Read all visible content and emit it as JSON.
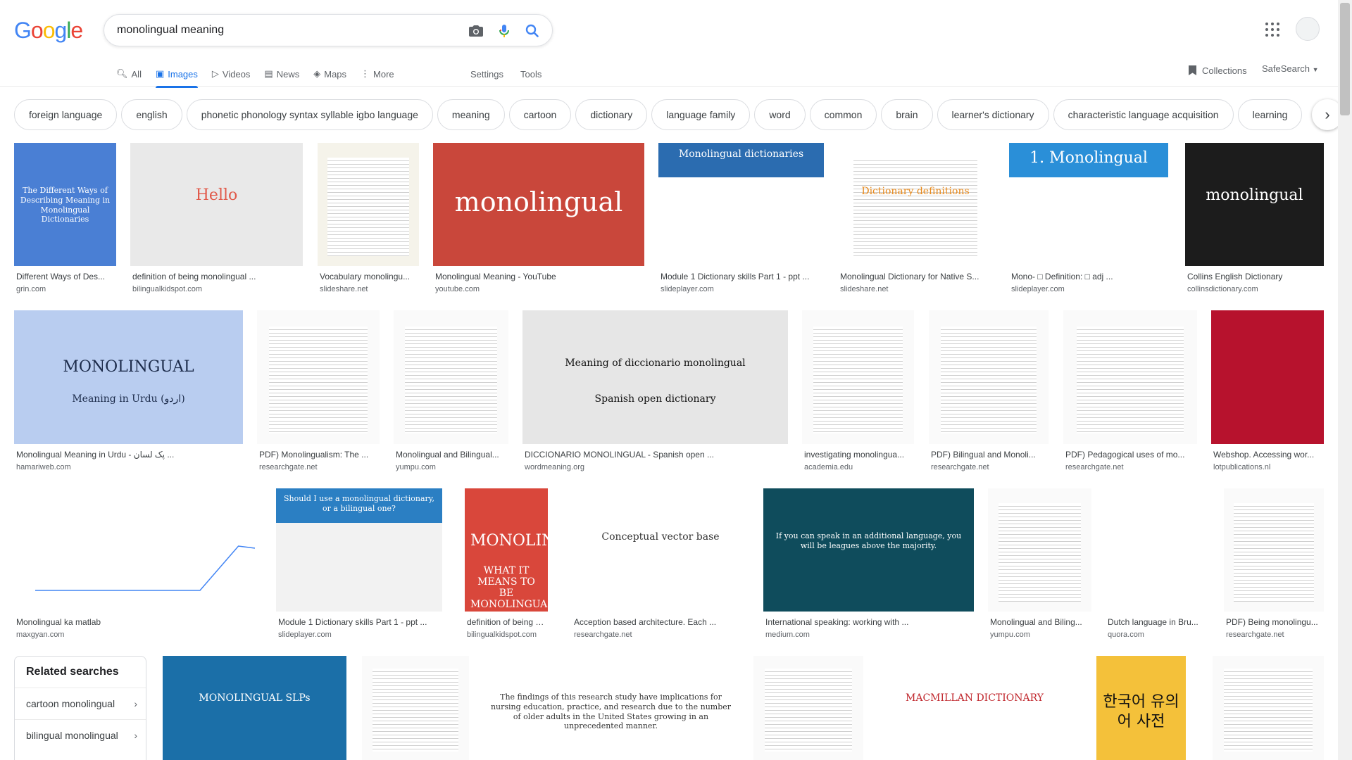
{
  "logo": [
    "G",
    "o",
    "o",
    "g",
    "l",
    "e"
  ],
  "search": {
    "query": "monolingual meaning"
  },
  "tabs": [
    {
      "label": "All",
      "icon": "search-icon"
    },
    {
      "label": "Images",
      "icon": "image-icon"
    },
    {
      "label": "Videos",
      "icon": "play-icon"
    },
    {
      "label": "News",
      "icon": "news-icon"
    },
    {
      "label": "Maps",
      "icon": "map-icon"
    },
    {
      "label": "More",
      "icon": "more-vert-icon"
    }
  ],
  "settings_label": "Settings",
  "tools_label": "Tools",
  "collections_label": "Collections",
  "safesearch_label": "SafeSearch",
  "chips": [
    "foreign language",
    "english",
    "phonetic phonology syntax syllable igbo language",
    "meaning",
    "cartoon",
    "dictionary",
    "language family",
    "word",
    "common",
    "brain",
    "learner's dictionary",
    "characteristic language acquisition",
    "learning"
  ],
  "results": [
    {
      "caption": "Different Ways of Des...",
      "source": "grin.com",
      "thumb_text": "The Different Ways of Describing Meaning in Monolingual Dictionaries"
    },
    {
      "caption": "definition of being monolingual ...",
      "source": "bilingualkidspot.com",
      "thumb_text": "Hello"
    },
    {
      "caption": "Vocabulary monolingu...",
      "source": "slideshare.net",
      "thumb_text": ""
    },
    {
      "caption": "Monolingual Meaning - YouTube",
      "source": "youtube.com",
      "thumb_text": "monolingual"
    },
    {
      "caption": "Module 1 Dictionary skills Part 1 - ppt ...",
      "source": "slideplayer.com",
      "thumb_text": "Monolingual dictionaries"
    },
    {
      "caption": "Monolingual Dictionary for Native S...",
      "source": "slideshare.net",
      "thumb_text": "Dictionary definitions"
    },
    {
      "caption": "Mono- □ Definition: □ adj ...",
      "source": "slideplayer.com",
      "thumb_text": "1. Monolingual"
    },
    {
      "caption": "Collins English Dictionary",
      "source": "collinsdictionary.com",
      "thumb_text": "monolingual"
    },
    {
      "caption": "Monolingual Meaning in Urdu - پک لسان ...",
      "source": "hamariweb.com",
      "thumb_text": "MONOLINGUAL",
      "thumb_sub": "Meaning in Urdu (اردو)"
    },
    {
      "caption": "PDF) Monolingualism: The ...",
      "source": "researchgate.net",
      "thumb_text": ""
    },
    {
      "caption": "Monolingual and Bilingual...",
      "source": "yumpu.com",
      "thumb_text": ""
    },
    {
      "caption": "DICCIONARIO MONOLINGUAL - Spanish open ...",
      "source": "wordmeaning.org",
      "thumb_text": "Meaning of diccionario monolingual",
      "thumb_sub": "Spanish open dictionary"
    },
    {
      "caption": "investigating monolingua...",
      "source": "academia.edu",
      "thumb_text": ""
    },
    {
      "caption": "PDF) Bilingual and Monoli...",
      "source": "researchgate.net",
      "thumb_text": ""
    },
    {
      "caption": "PDF) Pedagogical uses of mo...",
      "source": "researchgate.net",
      "thumb_text": ""
    },
    {
      "caption": "Webshop. Accessing wor...",
      "source": "lotpublications.nl",
      "thumb_text": ""
    },
    {
      "caption": "Monolingual ka matlab",
      "source": "maxgyan.com",
      "thumb_text": ""
    },
    {
      "caption": "Module 1 Dictionary skills Part 1 - ppt ...",
      "source": "slideplayer.com",
      "thumb_text": "Should I use a monolingual dictionary, or a bilingual one?"
    },
    {
      "caption": "definition of being mo...",
      "source": "bilingualkidspot.com",
      "thumb_text": "MONOLINGUALISM",
      "thumb_sub": "WHAT IT MEANS TO BE MONOLINGUAL"
    },
    {
      "caption": "Acception based architecture. Each ...",
      "source": "researchgate.net",
      "thumb_text": "Conceptual vector base"
    },
    {
      "caption": "International speaking: working with ...",
      "source": "medium.com",
      "thumb_text": "If you can speak in an additional language, you will be leagues above the majority."
    },
    {
      "caption": "Monolingual and Biling...",
      "source": "yumpu.com",
      "thumb_text": ""
    },
    {
      "caption": "Dutch language in Bru...",
      "source": "quora.com",
      "thumb_text": ""
    },
    {
      "caption": "PDF) Being monolingu...",
      "source": "researchgate.net",
      "thumb_text": ""
    },
    {
      "caption": "",
      "source": "",
      "thumb_text": "MONOLINGUAL SLPs"
    },
    {
      "caption": "",
      "source": "",
      "thumb_text": ""
    },
    {
      "caption": "",
      "source": "",
      "thumb_text": "The findings of this research study have implications for nursing education, practice, and research due to the number of older adults in the United States growing in an unprecedented manner."
    },
    {
      "caption": "",
      "source": "",
      "thumb_text": ""
    },
    {
      "caption": "",
      "source": "",
      "thumb_text": "MACMILLAN DICTIONARY"
    },
    {
      "caption": "",
      "source": "",
      "thumb_text": "한국어 유의어 사전"
    },
    {
      "caption": "",
      "source": "",
      "thumb_text": ""
    }
  ],
  "related": {
    "title": "Related searches",
    "items": [
      "cartoon monolingual",
      "bilingual monolingual"
    ]
  },
  "colors": {
    "accent": "#1a73e8",
    "chip_border": "#dadce0"
  }
}
